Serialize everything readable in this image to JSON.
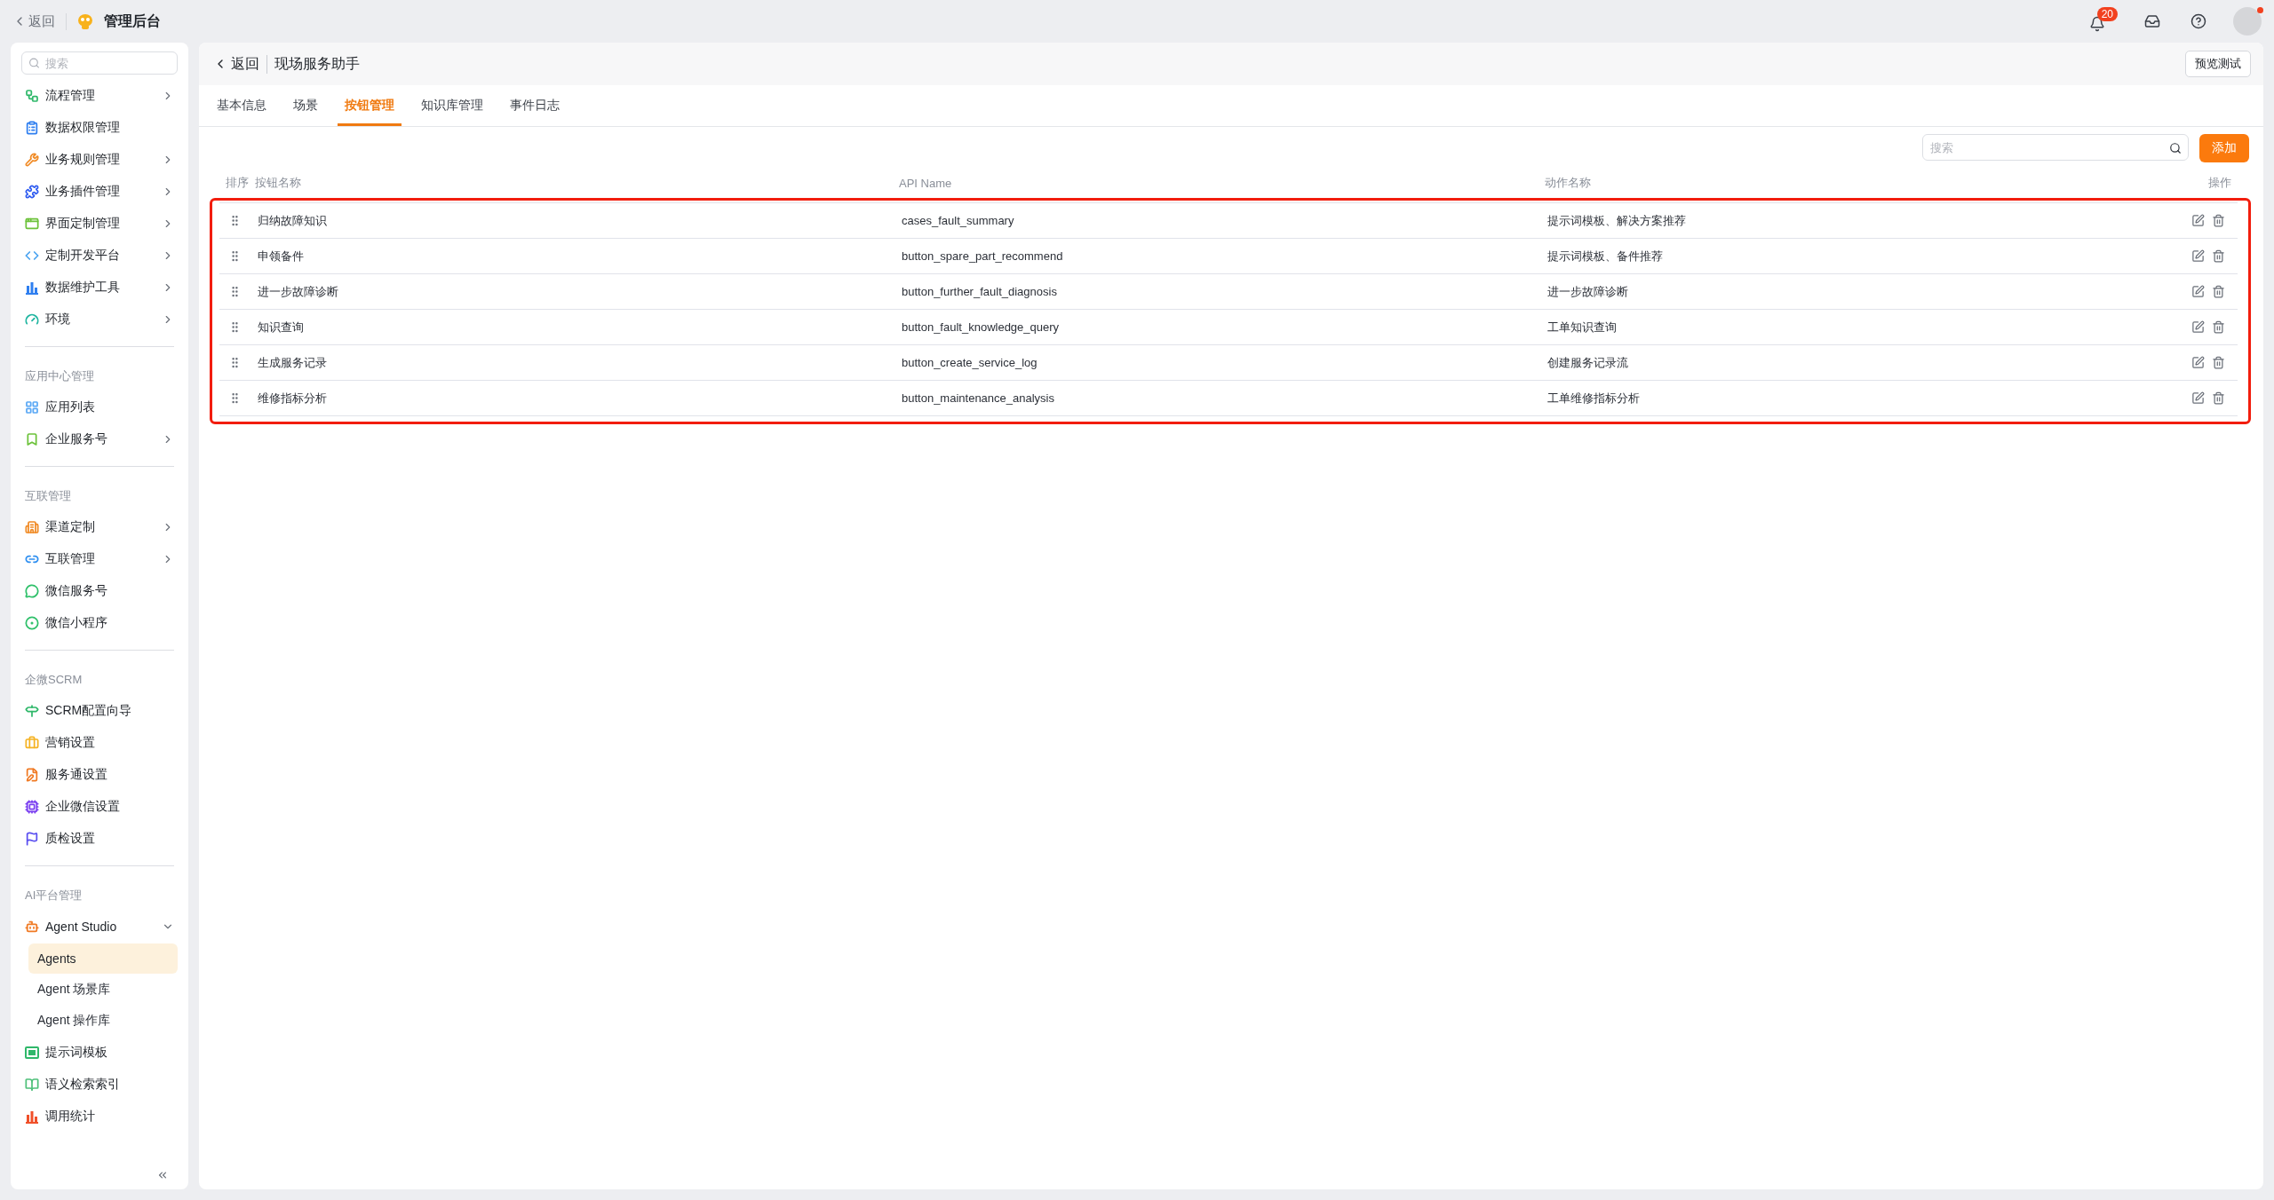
{
  "topbar": {
    "back": "返回",
    "app_title": "管理后台",
    "notifications": "20",
    "avatar_dot": true
  },
  "sidebar": {
    "search": {
      "placeholder": "搜索"
    },
    "sections": [
      {
        "items": [
          {
            "label": "流程管理",
            "color": "#2fb86a",
            "expandable": true,
            "expanded": false
          },
          {
            "label": "数据权限管理",
            "color": "#2f7ff0",
            "expandable": false
          },
          {
            "label": "业务规则管理",
            "color": "#f08a24",
            "expandable": true,
            "expanded": false
          },
          {
            "label": "业务插件管理",
            "color": "#2f5cf0",
            "expandable": true,
            "expanded": false
          },
          {
            "label": "界面定制管理",
            "color": "#6cc23a",
            "expandable": true,
            "expanded": false
          },
          {
            "label": "定制开发平台",
            "color": "#4aa3f0",
            "expandable": true,
            "expanded": false
          },
          {
            "label": "数据维护工具",
            "color": "#2f7ff0",
            "expandable": true,
            "expanded": false
          },
          {
            "label": "环境",
            "color": "#1fb5a0",
            "expandable": true,
            "expanded": false
          }
        ]
      },
      {
        "title": "应用中心管理",
        "items": [
          {
            "label": "应用列表",
            "color": "#5aa8f5",
            "expandable": false
          },
          {
            "label": "企业服务号",
            "color": "#6cc23a",
            "expandable": true,
            "expanded": false
          }
        ]
      },
      {
        "title": "互联管理",
        "items": [
          {
            "label": "渠道定制",
            "color": "#f08a24",
            "expandable": true,
            "expanded": false
          },
          {
            "label": "互联管理",
            "color": "#2f8ff0",
            "expandable": true,
            "expanded": false
          },
          {
            "label": "微信服务号",
            "color": "#2fc06a",
            "expandable": false
          },
          {
            "label": "微信小程序",
            "color": "#2fc06a",
            "expandable": false
          }
        ]
      },
      {
        "title": "企微SCRM",
        "items": [
          {
            "label": "SCRM配置向导",
            "color": "#2fb86a",
            "expandable": false
          },
          {
            "label": "营销设置",
            "color": "#f5b324",
            "expandable": false
          },
          {
            "label": "服务通设置",
            "color": "#f07a24",
            "expandable": false
          },
          {
            "label": "企业微信设置",
            "color": "#7a3ff0",
            "expandable": false
          },
          {
            "label": "质检设置",
            "color": "#5a4ff0",
            "expandable": false
          }
        ]
      },
      {
        "title": "AI平台管理",
        "items": [
          {
            "label": "Agent Studio",
            "color": "#f07a24",
            "expandable": true,
            "expanded": true,
            "children": [
              {
                "label": "Agents",
                "selected": true
              },
              {
                "label": "Agent 场景库",
                "selected": false
              },
              {
                "label": "Agent 操作库",
                "selected": false
              }
            ]
          },
          {
            "label": "提示词模板",
            "color": "#2fb86a",
            "expandable": false
          },
          {
            "label": "语义检索索引",
            "color": "#4fc07a",
            "expandable": false
          },
          {
            "label": "调用统计",
            "color": "#f0502a",
            "expandable": false
          }
        ]
      }
    ]
  },
  "page": {
    "back": "返回",
    "title": "现场服务助手",
    "preview_button": "预览测试",
    "tabs": [
      {
        "label": "基本信息",
        "selected": false
      },
      {
        "label": "场景",
        "selected": false
      },
      {
        "label": "按钮管理",
        "selected": true
      },
      {
        "label": "知识库管理",
        "selected": false
      },
      {
        "label": "事件日志",
        "selected": false
      }
    ],
    "search": {
      "placeholder": "搜索"
    },
    "add_button": "添加",
    "table": {
      "columns": [
        "排序",
        "按钮名称",
        "API Name",
        "动作名称",
        "操作"
      ],
      "highlighted": true,
      "rows": [
        {
          "name": "归纳故障知识",
          "api_name": "cases_fault_summary",
          "action": "提示词模板、解决方案推荐"
        },
        {
          "name": "申领备件",
          "api_name": "button_spare_part_recommend",
          "action": "提示词模板、备件推荐"
        },
        {
          "name": "进一步故障诊断",
          "api_name": "button_further_fault_diagnosis",
          "action": "进一步故障诊断"
        },
        {
          "name": "知识查询",
          "api_name": "button_fault_knowledge_query",
          "action": "工单知识查询"
        },
        {
          "name": "生成服务记录",
          "api_name": "button_create_service_log",
          "action": "创建服务记录流"
        },
        {
          "name": "维修指标分析",
          "api_name": "button_maintenance_analysis",
          "action": "工单维修指标分析"
        }
      ]
    }
  }
}
